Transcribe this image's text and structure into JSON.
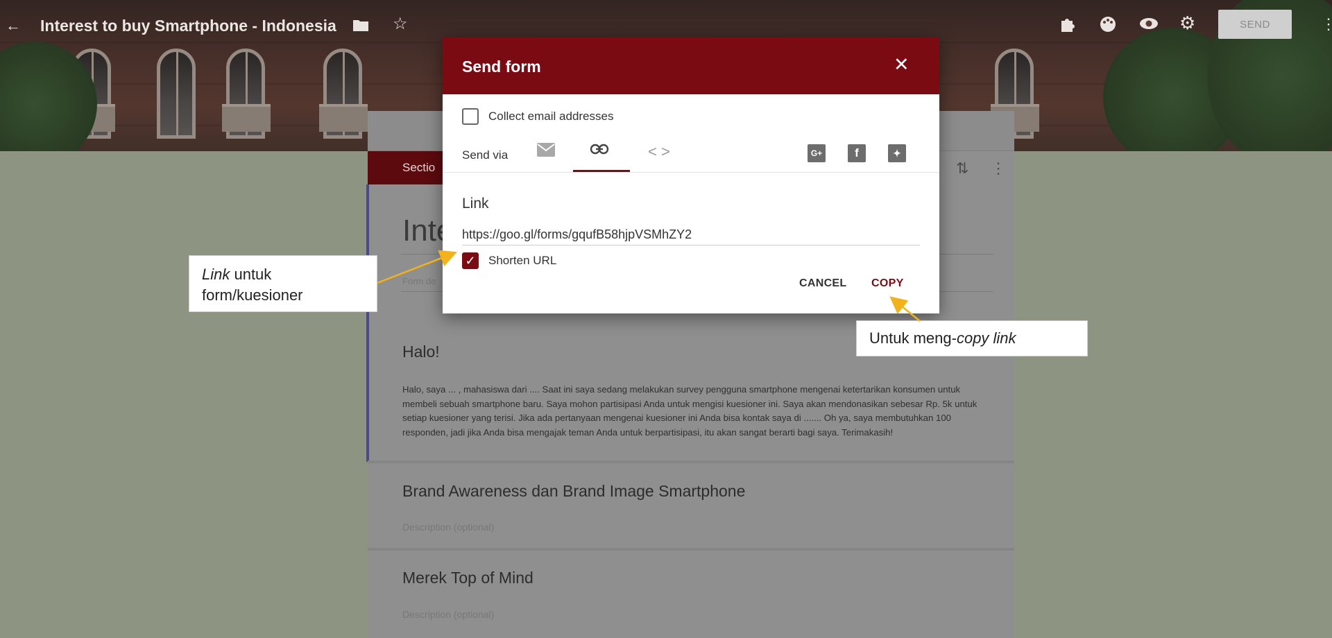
{
  "appbar": {
    "title": "Interest to buy Smartphone - Indonesia",
    "send_label": "SEND",
    "icons": [
      "back-arrow-icon",
      "folder-icon",
      "star-icon",
      "addon-puzzle-icon",
      "palette-icon",
      "preview-eye-icon",
      "settings-gear-icon",
      "more-vert-icon"
    ]
  },
  "form": {
    "section_chip": "Sectio",
    "title_partial": "Inte",
    "desc_placeholder_partial": "Form de",
    "sections": [
      {
        "title": "Halo!",
        "body": "Halo, saya ... , mahasiswa dari ....  Saat ini saya sedang melakukan survey pengguna smartphone mengenai ketertarikan konsumen untuk membeli sebuah smartphone baru. Saya mohon partisipasi Anda untuk mengisi kuesioner ini. Saya akan mendonasikan sebesar Rp. 5k untuk setiap kuesioner yang terisi. Jika ada pertanyaan mengenai kuesioner ini Anda bisa kontak saya di ....... Oh ya, saya membutuhkan 100 responden, jadi jika Anda bisa mengajak teman Anda untuk berpartisipasi, itu akan sangat berarti bagi saya.  Terimakasih!"
      },
      {
        "title": "Brand Awareness dan Brand Image Smartphone",
        "desc_placeholder": "Description (optional)"
      },
      {
        "title": "Merek Top of Mind",
        "desc_placeholder": "Description (optional)"
      }
    ]
  },
  "dialog": {
    "title": "Send form",
    "collect_email_label": "Collect email addresses",
    "collect_email_checked": false,
    "send_via_label": "Send via",
    "active_via": "link",
    "link_label": "Link",
    "link_url": "https://goo.gl/forms/gqufB58hjpVSMhZY2",
    "shorten_label": "Shorten URL",
    "shorten_checked": true,
    "cancel_label": "CANCEL",
    "copy_label": "COPY",
    "accent_color": "#7a0b12"
  },
  "annotations": {
    "link_callout_italic": "Link",
    "link_callout_rest1": " untuk",
    "link_callout_rest2": "form/kuesioner",
    "copy_callout_prefix": "Untuk meng-",
    "copy_callout_italic": "copy link",
    "arrow_color": "#f2b21b"
  }
}
